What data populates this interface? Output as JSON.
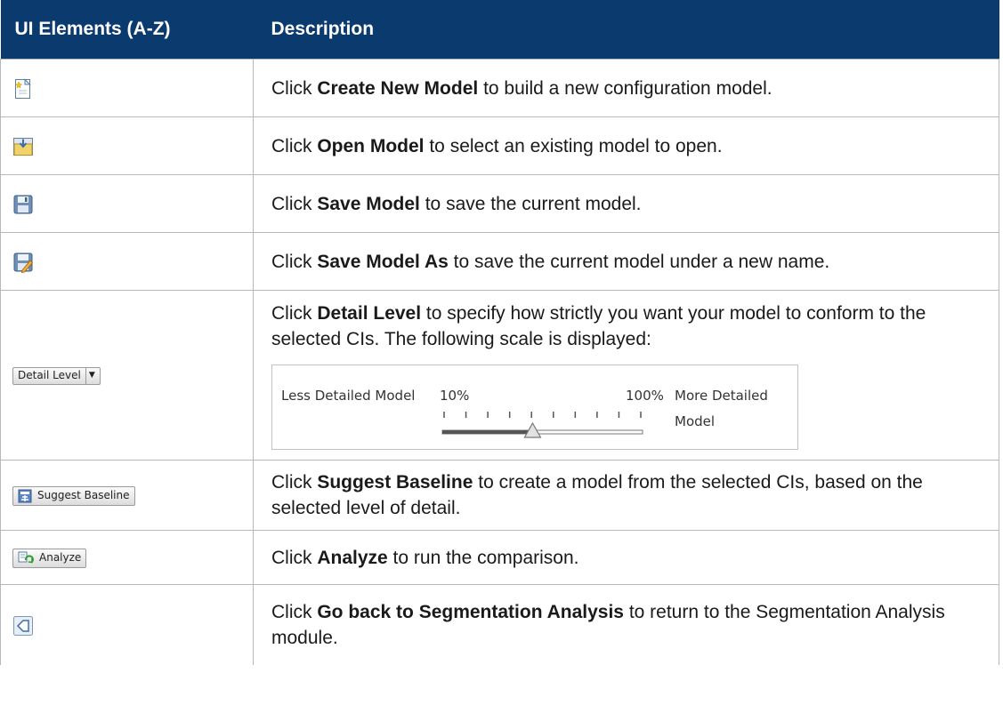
{
  "header": {
    "col1": "UI Elements (A-Z)",
    "col2": "Description"
  },
  "rows": [
    {
      "icon": "create-new-model-icon",
      "prefix": "Click ",
      "bold": "Create New Model",
      "suffix": " to build a new configuration model."
    },
    {
      "icon": "open-model-icon",
      "prefix": "Click ",
      "bold": "Open Model",
      "suffix": " to select an existing model to open."
    },
    {
      "icon": "save-model-icon",
      "prefix": "Click ",
      "bold": "Save Model",
      "suffix": " to save the current model."
    },
    {
      "icon": "save-model-as-icon",
      "prefix": "Click ",
      "bold": "Save Model As",
      "suffix": " to save the current model under a new name."
    },
    {
      "icon": "detail-level-dropdown",
      "control_label": "Detail Level",
      "prefix": "Click ",
      "bold": "Detail Level",
      "suffix": " to specify how strictly you want your model to conform to the selected CIs. The following scale is displayed:"
    },
    {
      "icon": "suggest-baseline-icon",
      "control_label": "Suggest Baseline",
      "prefix": "Click ",
      "bold": "Suggest Baseline",
      "suffix": " to create a model from the selected CIs, based on the selected level of detail."
    },
    {
      "icon": "analyze-icon",
      "control_label": "Analyze",
      "prefix": "Click ",
      "bold": "Analyze",
      "suffix": " to run the comparison."
    },
    {
      "icon": "go-back-icon",
      "prefix": "Click ",
      "bold": "Go back to Segmentation Analysis",
      "suffix": " to return to the Segmentation Analysis module."
    }
  ],
  "scale": {
    "left_label": "Less Detailed Model",
    "min_label": "10%",
    "max_label": "100%",
    "right_label": "More Detailed Model",
    "tick_count": 10,
    "level_fraction": 0.45
  },
  "colors": {
    "header_bg": "#0b3a6e",
    "header_text": "#ffffff",
    "border": "#b8b8b8"
  }
}
